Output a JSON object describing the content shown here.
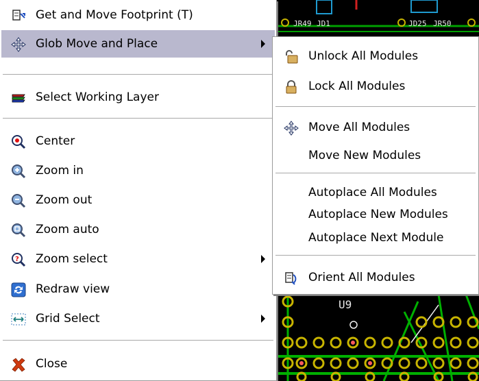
{
  "main_menu": {
    "items": [
      {
        "label": "Get and Move Footprint (T)",
        "icon": "footprint-icon"
      },
      {
        "label": "Glob Move and Place",
        "icon": "move-cross-icon"
      },
      {
        "label": "Select Working Layer",
        "icon": "layers-icon"
      },
      {
        "label": "Center",
        "icon": "center-magnifier-icon"
      },
      {
        "label": "Zoom in",
        "icon": "zoom-in-icon"
      },
      {
        "label": "Zoom out",
        "icon": "zoom-out-icon"
      },
      {
        "label": "Zoom auto",
        "icon": "zoom-auto-icon"
      },
      {
        "label": "Zoom select",
        "icon": "zoom-select-icon"
      },
      {
        "label": "Redraw view",
        "icon": "redraw-icon"
      },
      {
        "label": "Grid Select",
        "icon": "grid-icon"
      },
      {
        "label": "Close",
        "icon": "close-x-icon"
      }
    ]
  },
  "sub_menu": {
    "items": [
      {
        "label": "Unlock All Modules",
        "icon": "unlock-icon"
      },
      {
        "label": "Lock All Modules",
        "icon": "lock-icon"
      },
      {
        "label": "Move All Modules",
        "icon": "move-cross-icon"
      },
      {
        "label": "Move New Modules"
      },
      {
        "label": "Autoplace All Modules"
      },
      {
        "label": "Autoplace New Modules"
      },
      {
        "label": "Autoplace Next Module"
      },
      {
        "label": "Orient All Modules",
        "icon": "orient-icon"
      }
    ]
  },
  "pcb": {
    "top_refs": [
      "JR49",
      "JD1",
      "JD25",
      "JR50"
    ],
    "component_ref": "U9"
  },
  "colors": {
    "menu_highlight": "#b9b8ce",
    "pcb_background": "#000000",
    "pcb_track": "#00b000",
    "pad": "#c8b400"
  }
}
